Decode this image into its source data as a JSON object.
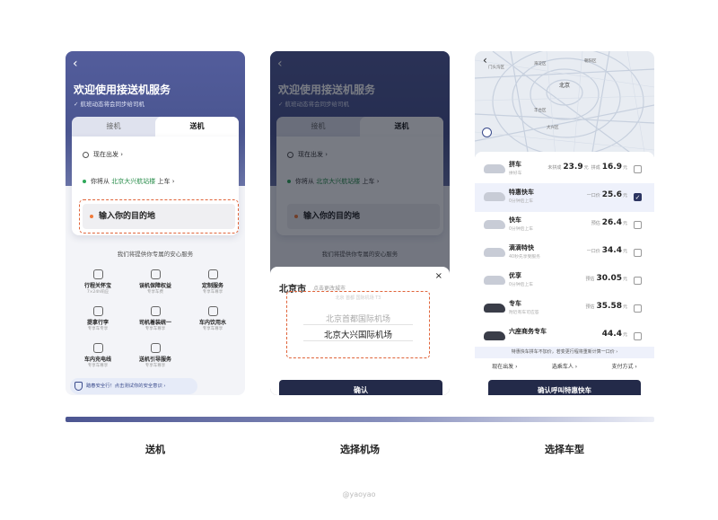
{
  "pickup_screen": {
    "back": "‹",
    "title": "欢迎使用接送机服务",
    "subtitle": "✓ 航班动态将会同步给司机",
    "tabs": [
      "接机",
      "送机"
    ],
    "time": "现在出发",
    "from_prefix": "你将从",
    "from_place": "北京大兴航站楼",
    "from_suffix": "上车",
    "destination": "输入你的目的地",
    "services_title": "我们将提供你专属的安心服务",
    "services": [
      {
        "name": "行程关怀宝",
        "desc": "7×24h响应"
      },
      {
        "name": "误机保障权益",
        "desc": "专享车费"
      },
      {
        "name": "定制服务",
        "desc": "专享车尊享"
      },
      {
        "name": "提拿行李",
        "desc": "专享车专享"
      },
      {
        "name": "司机着装统一",
        "desc": "专享车尊享"
      },
      {
        "name": "车内饮用水",
        "desc": "专享车尊享"
      },
      {
        "name": "车内充电线",
        "desc": "专享车尊享"
      },
      {
        "name": "送机引导服务",
        "desc": "专享车尊享"
      }
    ],
    "safety_tip": "踏春安全行！点击测试你的安全意识 ›"
  },
  "airport_screen": {
    "city": "北京市",
    "city_hint": "点击更改城市",
    "faded_row": "北京 首都 国际机场 T3",
    "options": [
      "北京首都国际机场",
      "北京大兴国际机场"
    ],
    "confirm": "确认",
    "close": "×"
  },
  "car_screen": {
    "map_labels": [
      "北京",
      "海淀区",
      "朝阳区",
      "丰台区",
      "大兴区",
      "门头沟区"
    ],
    "cars": [
      {
        "name": "拼车",
        "desc": "拼好车",
        "price_prefix": "未拼成",
        "price": "23.9",
        "price2_prefix": "拼成",
        "price2": "16.9",
        "unit": "元",
        "checked": false,
        "dark": false
      },
      {
        "name": "特惠快车",
        "desc": "0分钟后上车",
        "price_prefix": "一口价",
        "price": "25.6",
        "unit": "元",
        "checked": true,
        "dark": false
      },
      {
        "name": "快车",
        "desc": "0分钟后上车",
        "price_prefix": "预估",
        "price": "26.4",
        "unit": "元",
        "checked": false,
        "dark": false
      },
      {
        "name": "滴滴特快",
        "desc": "40秒先享受服务",
        "price_prefix": "一口价",
        "price": "34.4",
        "unit": "元",
        "checked": false,
        "dark": false
      },
      {
        "name": "优享",
        "desc": "0分钟后上车",
        "price_prefix": "预估",
        "price": "30.05",
        "unit": "元",
        "checked": false,
        "dark": false
      },
      {
        "name": "专车",
        "desc": "附近有车可应答",
        "price_prefix": "预估",
        "price": "35.58",
        "unit": "元",
        "checked": false,
        "dark": true
      },
      {
        "name": "六座商务专车",
        "desc": "",
        "price_prefix": "",
        "price": "44.4",
        "unit": "元",
        "checked": false,
        "dark": true
      }
    ],
    "notice": "特惠快车拼车不加价，若变更行程将重新计算一口价 ›",
    "options": [
      "现在出发 ›",
      "选乘车人 ›",
      "支付方式 ›"
    ],
    "call_button": "确认呼叫特惠快车"
  },
  "captions": [
    "送机",
    "选择机场",
    "选择车型"
  ],
  "credit": "@yaoyao"
}
